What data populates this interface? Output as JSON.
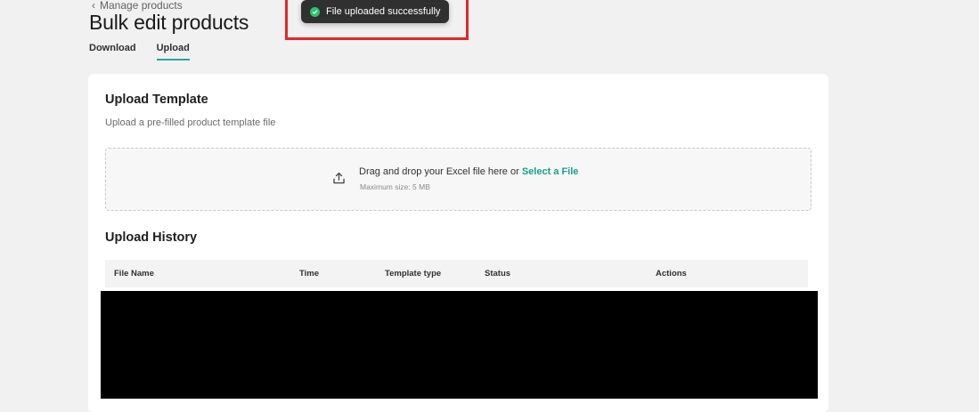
{
  "breadcrumb": {
    "label": "Manage products"
  },
  "page": {
    "title": "Bulk edit products"
  },
  "tabs": [
    {
      "label": "Download",
      "active": false
    },
    {
      "label": "Upload",
      "active": true
    }
  ],
  "toast": {
    "message": "File uploaded successfully",
    "icon": "check-circle-icon",
    "icon_color": "#29c469"
  },
  "upload_template": {
    "title": "Upload Template",
    "subtitle": "Upload a pre-filled product template file",
    "dropzone": {
      "text": "Drag and drop your Excel file here or",
      "link": "Select a File",
      "hint": "Maximum size: 5 MB",
      "icon": "upload-icon"
    }
  },
  "upload_history": {
    "title": "Upload History",
    "columns": [
      "File Name",
      "Time",
      "Template type",
      "Status",
      "Actions"
    ]
  },
  "colors": {
    "accent": "#1a9e8e",
    "tab_underline": "#26a69a",
    "highlight_border": "#e4262b",
    "background": "#f1f1f1"
  }
}
